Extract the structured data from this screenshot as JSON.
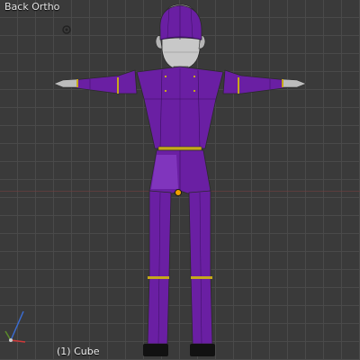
{
  "viewport": {
    "view_label": "Back Ortho",
    "active_object_label": "(1) Cube"
  },
  "colors": {
    "background": "#3a3a3a",
    "body_purple": "#6a1fa3",
    "belt_yellow": "#c7a91a",
    "skin_gray": "#bdbdbd",
    "shoe_black": "#111111",
    "axis_x": "#d23a3a",
    "axis_y": "#5a8a2a",
    "axis_z": "#3a6cd2"
  },
  "icons": {
    "cursor": "3d-cursor-icon",
    "origin": "object-origin-icon",
    "axes": "axis-gizmo-icon"
  }
}
